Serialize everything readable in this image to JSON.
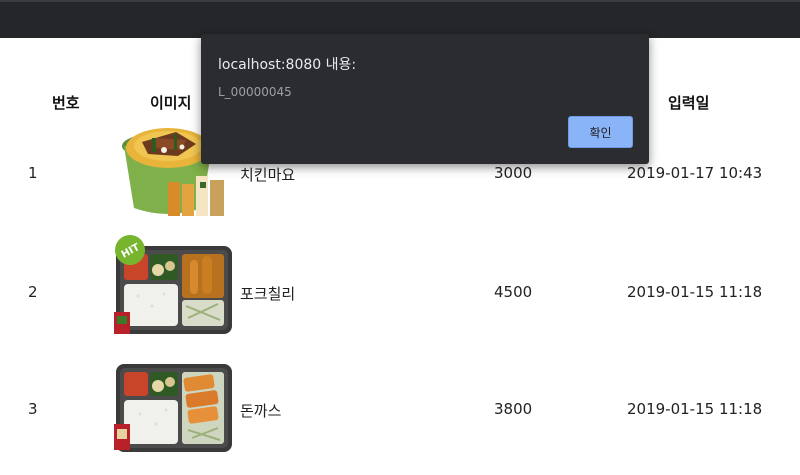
{
  "table": {
    "headers": {
      "number": "번호",
      "image": "이미지",
      "date": "입력일"
    },
    "rows": [
      {
        "number": "1",
        "name": "치킨마요",
        "price": "3000",
        "date": "2019-01-17 10:43"
      },
      {
        "number": "2",
        "name": "포크칠리",
        "price": "4500",
        "date": "2019-01-15 11:18"
      },
      {
        "number": "3",
        "name": "돈까스",
        "price": "3800",
        "date": "2019-01-15 11:18"
      }
    ]
  },
  "dialog": {
    "title": "localhost:8080 내용:",
    "message": "L_00000045",
    "ok_label": "확인",
    "ok_color": "#8ab4f8",
    "background": "#2b2c30"
  },
  "badge": {
    "text": "HIT"
  }
}
